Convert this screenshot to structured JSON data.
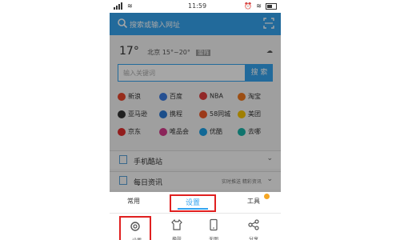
{
  "status_bar": {
    "time": "11:59",
    "network": "ull",
    "battery_icon": "battery-icon"
  },
  "header": {
    "search_hint": "搜索或输入网址",
    "search_icon": "search-icon",
    "scan_icon": "scan-icon"
  },
  "weather": {
    "temp": "17°",
    "range": "北京 15°~20°",
    "tag": "雷阵"
  },
  "search_box": {
    "placeholder": "输入关键词",
    "button": "搜 索"
  },
  "grid": [
    [
      "新浪",
      "百度",
      "NBA",
      "淘宝"
    ],
    [
      "亚马逊",
      "携程",
      "58同城",
      "美团"
    ],
    [
      "京东",
      "唯品会",
      "优酷",
      "去哪"
    ]
  ],
  "rows": [
    {
      "label": "手机酷站",
      "extra": ""
    },
    {
      "label": "每日资讯",
      "extra": "实时推送 精彩资讯"
    }
  ],
  "sheet": {
    "tabs": [
      "常用",
      "设置",
      "工具"
    ],
    "selected_tab": 1,
    "items": [
      "设置",
      "换肤",
      "无图",
      "分享"
    ]
  },
  "colors": {
    "accent": "#35a3ef",
    "highlight": "#e02020"
  }
}
